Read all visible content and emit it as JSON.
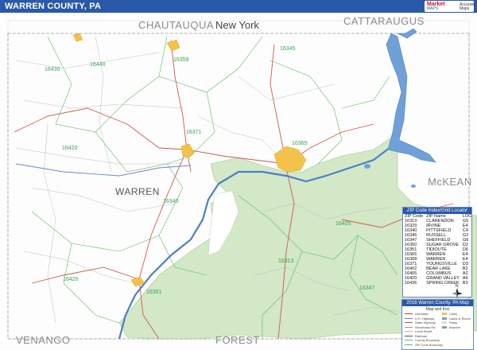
{
  "title": "WARREN COUNTY, PA",
  "logo": {
    "line1": "Market",
    "line2": "MAPS",
    "line3": "Accurate Maps"
  },
  "labels": {
    "chautauqua": "CHAUTAUQUA",
    "new_york": "New York",
    "cattaraugus": "CATTARAUGUS",
    "warren_county": "WARREN",
    "mckean": "McKEAN",
    "venango": "VENANGO",
    "forest": "FOREST"
  },
  "zip_labels": [
    {
      "code": "16345"
    },
    {
      "code": "16440"
    },
    {
      "code": "16430"
    },
    {
      "code": "16359"
    },
    {
      "code": "16371"
    },
    {
      "code": "16365"
    },
    {
      "code": "16420"
    },
    {
      "code": "16340"
    },
    {
      "code": "16405"
    },
    {
      "code": "16313"
    },
    {
      "code": "16420"
    },
    {
      "code": "16351"
    },
    {
      "code": "16347"
    }
  ],
  "zip_table": {
    "header": "ZIP Code Index/Grid Locator",
    "columns": [
      "ZIP Code",
      "ZIP Name",
      "LOC"
    ],
    "rows": [
      [
        "16313",
        "CLARENDON",
        "G5"
      ],
      [
        "16329",
        "IRVINE",
        "E4"
      ],
      [
        "16340",
        "PITTSFIELD",
        "C4"
      ],
      [
        "16345",
        "RUSSELL",
        "G2"
      ],
      [
        "16347",
        "SHEFFIELD",
        "G6"
      ],
      [
        "16350",
        "SUGAR GROVE",
        "D2"
      ],
      [
        "16351",
        "TIDIOUTE",
        "D6"
      ],
      [
        "16365",
        "WARREN",
        "E4"
      ],
      [
        "16368",
        "WARREN",
        "E4"
      ],
      [
        "16371",
        "YOUNGSVILLE",
        "D3"
      ],
      [
        "16402",
        "BEAR LAKE",
        "B2"
      ],
      [
        "16405",
        "COLUMBUS",
        "A2"
      ],
      [
        "16420",
        "GRAND VALLEY",
        "A6"
      ],
      [
        "16436",
        "SPRING CREEK",
        "B3"
      ]
    ]
  },
  "legend": {
    "header": "2016 Warren County, PA Map",
    "subtitle": "Map and Key",
    "rows_left": [
      "Interstate",
      "U.S. Highway",
      "State Highway",
      "Secondary Rd",
      "Local Street",
      "Railroad",
      "County Boundary",
      "ZIP Code Boundary"
    ],
    "rows_right": [
      "Cities",
      "Lakes & Rivers",
      "Parks",
      "Airports"
    ]
  },
  "colors": {
    "title_bar": "#2a59a8",
    "water": "#4d7fc4",
    "forest": "#cfe6c4",
    "city": "#f2c24a",
    "road_major": "#c0392b",
    "zip_boundary": "#3aa24a"
  }
}
